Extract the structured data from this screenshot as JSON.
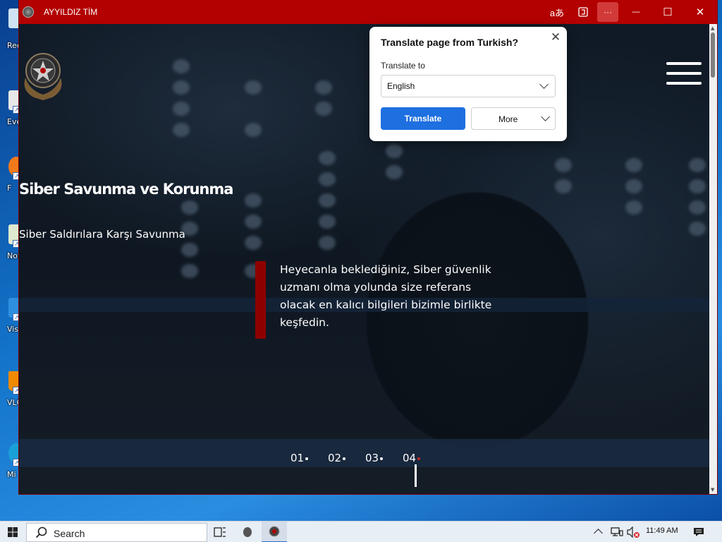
{
  "desktop": {
    "icons": [
      {
        "label": "Rec"
      },
      {
        "label": "Eve"
      },
      {
        "label": "F"
      },
      {
        "label": "Not"
      },
      {
        "label": "Visu"
      },
      {
        "label": "VLC"
      },
      {
        "label": "Mi"
      }
    ]
  },
  "window": {
    "title": "AYYILDIZ TİM",
    "controls": {
      "more": "···",
      "minimize": "—",
      "maximize": "☐",
      "close": "✕"
    }
  },
  "site": {
    "hero_title": "Siber Savunma ve Korunma",
    "hero_subtitle": "Siber Saldırılara Karşı Savunma",
    "quote": "Heyecanla beklediğiniz, Siber güvenlik\nuzmanı olma yolunda size referans\n olacak en kalıcı bilgileri bizimle birlikte\nkeşfedin.",
    "pager": [
      "01",
      "02",
      "03",
      "04"
    ],
    "active_slide": 3
  },
  "translate_popup": {
    "title": "Translate page from Turkish?",
    "label": "Translate to",
    "selected_language": "English",
    "translate_button": "Translate",
    "more_button": "More",
    "close": "✕"
  },
  "taskbar": {
    "search_label": "Search",
    "time": "11:49 AM"
  },
  "colors": {
    "titlebar": "#b30000",
    "accent_bar": "#8e0000",
    "translate_button": "#1e6fe0"
  }
}
